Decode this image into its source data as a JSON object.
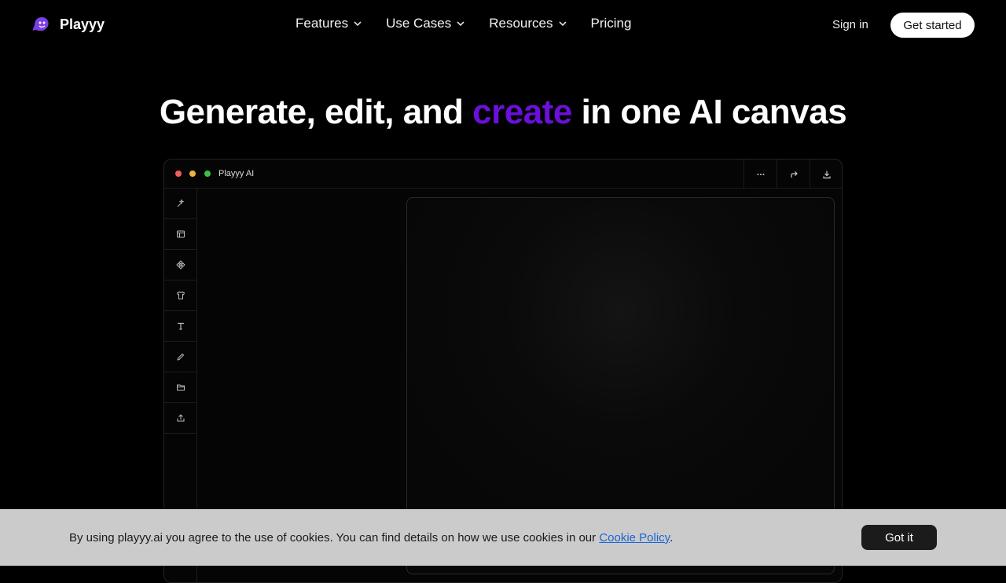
{
  "brand": {
    "name": "Playyy",
    "accent_color": "#6a10d9"
  },
  "nav": {
    "items": [
      {
        "label": "Features",
        "has_dropdown": true
      },
      {
        "label": "Use Cases",
        "has_dropdown": true
      },
      {
        "label": "Resources",
        "has_dropdown": true
      },
      {
        "label": "Pricing",
        "has_dropdown": false
      }
    ],
    "sign_in": "Sign in",
    "get_started": "Get started"
  },
  "hero": {
    "before": "Generate, edit, and ",
    "highlight": "create",
    "after": " in one AI canvas"
  },
  "app_window": {
    "title": "Playyy AI",
    "toolbar_icons": [
      "more-icon",
      "redo-icon",
      "download-icon"
    ],
    "sidebar_tools": [
      "magic-wand-icon",
      "layout-icon",
      "components-icon",
      "shirt-icon",
      "text-icon",
      "pencil-icon",
      "folder-icon",
      "upload-icon"
    ]
  },
  "cookie": {
    "text": "By using playyy.ai you agree to the use of cookies. You can find details on how we use cookies in our ",
    "link": "Cookie Policy",
    "suffix": ".",
    "button": "Got it"
  }
}
